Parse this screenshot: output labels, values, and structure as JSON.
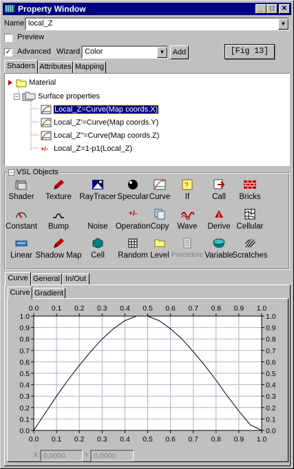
{
  "window": {
    "title": "Property Window",
    "minimize": "_",
    "maximize": "□",
    "close": "✕"
  },
  "name_row": {
    "label": "Name",
    "value": "local_Z"
  },
  "preview": {
    "label": "Preview",
    "checked": false
  },
  "advanced": {
    "label": "Advanced",
    "checked": true
  },
  "wizard": {
    "label": "Wizard",
    "value": "Color",
    "add_label": "Add"
  },
  "fig_label": "[Fig 13]",
  "top_tabs": [
    {
      "label": "Shaders",
      "active": true
    },
    {
      "label": "Attributes",
      "active": false
    },
    {
      "label": "Mapping",
      "active": false
    }
  ],
  "tree": {
    "material": "Material",
    "surface": "Surface properties",
    "items": [
      {
        "label": "Local_Z=Curve(Map coords.X)",
        "selected": true
      },
      {
        "label": "Local_Z'=Curve(Map coords.Y)",
        "selected": false
      },
      {
        "label": "Local_Z\"=Curve(Map coords.Z)",
        "selected": false
      },
      {
        "label": "Local_Z=1-p1(Local_Z)",
        "selected": false
      }
    ]
  },
  "vsl": {
    "title": "VSL Objects",
    "collapse": "−",
    "rows": [
      [
        "Shader",
        "Texture",
        "RayTracer",
        "Specular",
        "Curve",
        "If",
        "Call",
        "Bricks"
      ],
      [
        "Constant",
        "Bump",
        "Noise",
        "Operation",
        "Copy",
        "Wave",
        "Derive",
        "Cellular"
      ],
      [
        "Linear",
        "Shadow Map",
        "Cell",
        "Random",
        "Level",
        "Procedure",
        "Variable",
        "Scratches"
      ]
    ],
    "disabled": [
      "Procedure"
    ]
  },
  "bottom_tabs": [
    {
      "label": "Curve",
      "active": true
    },
    {
      "label": "General",
      "active": false
    },
    {
      "label": "In/Out",
      "active": false
    }
  ],
  "sub_tabs": [
    {
      "label": "Curve",
      "active": true
    },
    {
      "label": "Gradient",
      "active": false
    }
  ],
  "chart_data": {
    "type": "line",
    "x_ticks": [
      "0.0",
      "0.1",
      "0.2",
      "0.3",
      "0.4",
      "0.5",
      "0.6",
      "0.7",
      "0.8",
      "0.9",
      "1.0"
    ],
    "y_ticks": [
      "1.0",
      "0.9",
      "0.8",
      "0.7",
      "0.6",
      "0.5",
      "0.4",
      "0.3",
      "0.2",
      "0.1",
      "0.0"
    ],
    "xlim": [
      0,
      1
    ],
    "ylim": [
      0,
      1
    ],
    "grid": true,
    "series": [
      {
        "color": "#000000",
        "x": [
          0.0,
          0.05,
          0.1,
          0.15,
          0.2,
          0.25,
          0.3,
          0.35,
          0.4,
          0.45,
          0.5,
          0.55,
          0.6,
          0.65,
          0.7,
          0.75,
          0.8,
          0.85,
          0.9,
          0.95,
          1.0
        ],
        "y": [
          0.0,
          0.15,
          0.3,
          0.44,
          0.57,
          0.69,
          0.8,
          0.89,
          0.96,
          1.0,
          1.0,
          0.96,
          0.89,
          0.8,
          0.69,
          0.57,
          0.44,
          0.3,
          0.17,
          0.05,
          0.0
        ]
      }
    ]
  },
  "coords": {
    "x_label": "X",
    "x_value": "0,0000",
    "y_label": "Y",
    "y_value": "0,0000"
  }
}
